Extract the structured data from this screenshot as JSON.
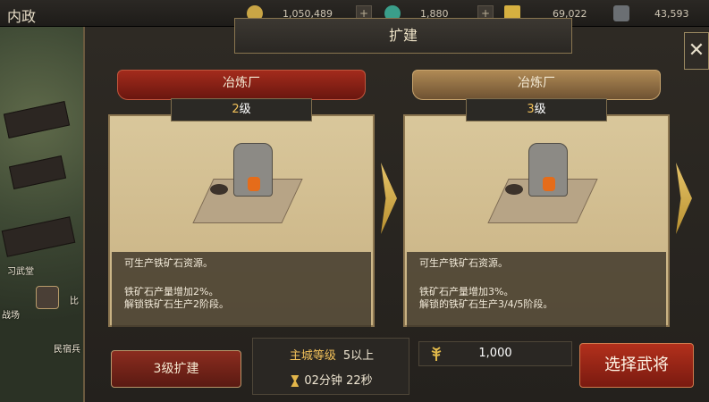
{
  "topbar": {
    "title": "内政",
    "resources": [
      {
        "icon": "coin-icon",
        "value": "1,050,489"
      },
      {
        "icon": "jade-icon",
        "value": "1,880"
      },
      {
        "icon": "wheat-icon",
        "value": "69,022"
      },
      {
        "icon": "iron-icon",
        "value": "43,593"
      }
    ]
  },
  "map": {
    "labels": [
      "习武堂",
      "战场",
      "民宿兵",
      "比"
    ]
  },
  "dialog": {
    "title": "扩建",
    "close": "✕"
  },
  "cards": [
    {
      "name": "冶炼厂",
      "level_num": "2",
      "level_suffix": "级",
      "desc1": "可生产铁矿石资源。",
      "desc2": "铁矿石产量增加2%。",
      "desc3": "解锁铁矿石生产2阶段。"
    },
    {
      "name": "冶炼厂",
      "level_num": "3",
      "level_suffix": "级",
      "desc1": "可生产铁矿石资源。",
      "desc2": "铁矿石产量增加3%。",
      "desc3": "解锁的铁矿石生产3/4/5阶段。"
    }
  ],
  "bottom": {
    "upgrade_label": "3级扩建",
    "req_key": "主城等级",
    "req_val": "5以上",
    "time": "02分钟 22秒",
    "cost": "1,000",
    "select_label": "选择武将"
  }
}
